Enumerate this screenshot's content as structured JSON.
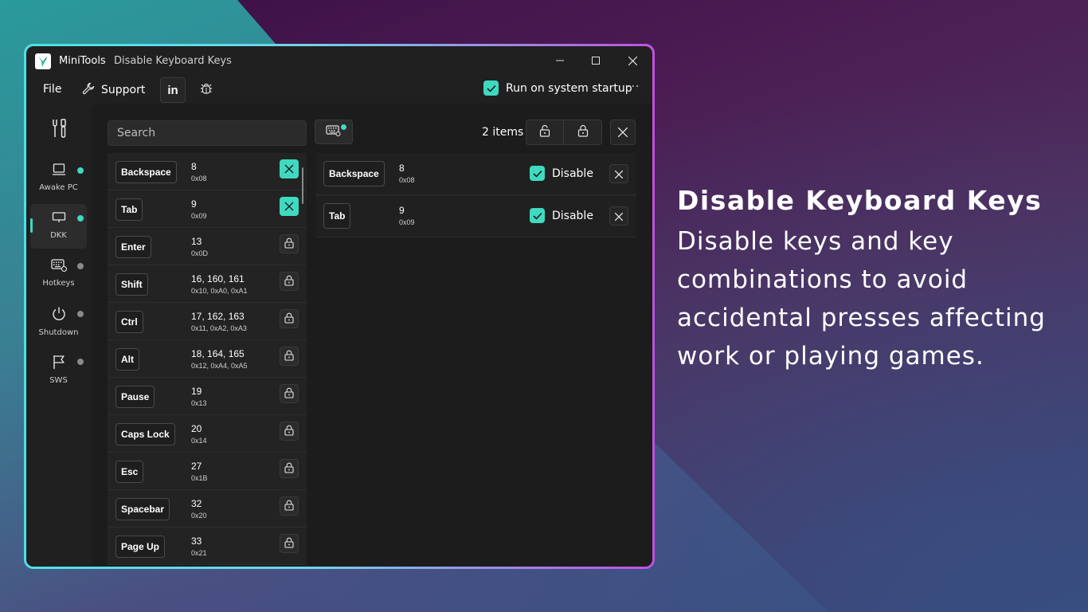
{
  "window": {
    "app_name": "MiniTools",
    "title": "Disable Keyboard Keys"
  },
  "menu": {
    "file": "File",
    "support": "Support",
    "run_on_startup": "Run on system startup",
    "more": "···"
  },
  "nav": {
    "items": [
      {
        "label": "Awake PC",
        "status_color": "#3fd9c0",
        "icon": "monitor-icon"
      },
      {
        "label": "DKK",
        "status_color": "#3fd9c0",
        "icon": "keyboard-icon",
        "active": true
      },
      {
        "label": "Hotkeys",
        "status_color": "#8a8a8a",
        "icon": "hotkeys-icon"
      },
      {
        "label": "Shutdown",
        "status_color": "#8a8a8a",
        "icon": "power-icon"
      },
      {
        "label": "SWS",
        "status_color": "#8a8a8a",
        "icon": "flag-icon"
      }
    ]
  },
  "toolbar": {
    "search_placeholder": "Search",
    "items_count": "2 items"
  },
  "keys": [
    {
      "name": "Backspace",
      "code": "8",
      "hex": "0x08",
      "state": "disabled"
    },
    {
      "name": "Tab",
      "code": "9",
      "hex": "0x09",
      "state": "disabled"
    },
    {
      "name": "Enter",
      "code": "13",
      "hex": "0x0D",
      "state": "locked"
    },
    {
      "name": "Shift",
      "code": "16, 160, 161",
      "hex": "0x10, 0xA0, 0xA1",
      "state": "locked"
    },
    {
      "name": "Ctrl",
      "code": "17, 162, 163",
      "hex": "0x11, 0xA2, 0xA3",
      "state": "locked"
    },
    {
      "name": "Alt",
      "code": "18, 164, 165",
      "hex": "0x12, 0xA4, 0xA5",
      "state": "locked"
    },
    {
      "name": "Pause",
      "code": "19",
      "hex": "0x13",
      "state": "locked"
    },
    {
      "name": "Caps Lock",
      "code": "20",
      "hex": "0x14",
      "state": "locked"
    },
    {
      "name": "Esc",
      "code": "27",
      "hex": "0x1B",
      "state": "locked"
    },
    {
      "name": "Spacebar",
      "code": "32",
      "hex": "0x20",
      "state": "locked"
    },
    {
      "name": "Page Up",
      "code": "33",
      "hex": "0x21",
      "state": "locked"
    }
  ],
  "disabled_keys": [
    {
      "name": "Backspace",
      "code": "8",
      "hex": "0x08",
      "check_label": "Disable"
    },
    {
      "name": "Tab",
      "code": "9",
      "hex": "0x09",
      "check_label": "Disable"
    }
  ],
  "promo": {
    "title": "Disable Keyboard Keys",
    "description": "Disable keys and key combinations to avoid accidental presses affecting work or playing games."
  },
  "colors": {
    "accent": "#3fd9c0",
    "window_bg": "#202020"
  }
}
